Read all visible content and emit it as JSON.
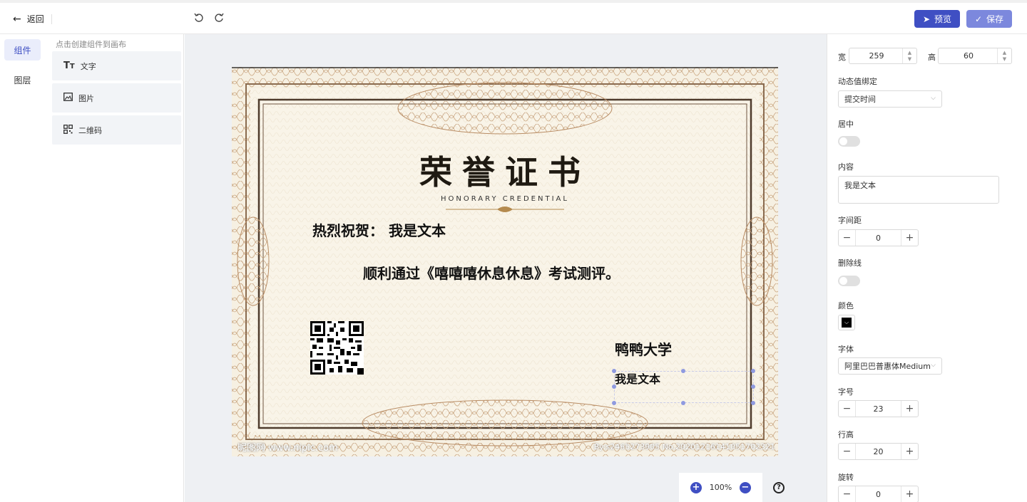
{
  "header": {
    "back_label": "返回",
    "preview_label": "预览",
    "save_label": "保存",
    "accent": "#3f4fc3"
  },
  "left_tabs": [
    {
      "label": "组件",
      "active": true
    },
    {
      "label": "图层",
      "active": false
    }
  ],
  "components_panel": {
    "hint": "点击创建组件到画布",
    "items": [
      {
        "label": "文字",
        "icon": "text-icon"
      },
      {
        "label": "图片",
        "icon": "image-icon"
      },
      {
        "label": "二维码",
        "icon": "qrcode-icon"
      }
    ]
  },
  "certificate": {
    "title": "荣誉证书",
    "subtitle": "HONORARY CREDENTIAL",
    "line1": "热烈祝贺： 我是文本",
    "line2": "顺利通过《嘻嘻嘻休息休息》考试测评。",
    "school": "鸭鸭大学",
    "selected_text": "我是文本",
    "watermark_left": "昵图网 www.nipic.com",
    "watermark_right": "By:s2465273905 No.20201216141051702321"
  },
  "zoom": {
    "level": "100%",
    "zoom_in": "+",
    "zoom_out": "−",
    "help": "?"
  },
  "properties": {
    "width_label": "宽",
    "width_value": "259",
    "height_label": "高",
    "height_value": "60",
    "binding_label": "动态值绑定",
    "binding_value": "提交时间",
    "center_label": "居中",
    "center_on": false,
    "content_label": "内容",
    "content_value": "我是文本",
    "letter_spacing_label": "字间距",
    "letter_spacing_value": "0",
    "strike_label": "删除线",
    "strike_on": false,
    "color_label": "颜色",
    "color_value": "#000000",
    "font_label": "字体",
    "font_value": "阿里巴巴普惠体Medium",
    "size_label": "字号",
    "size_value": "23",
    "line_height_label": "行高",
    "line_height_value": "20",
    "rotate_label": "旋转",
    "rotate_value": "0"
  }
}
